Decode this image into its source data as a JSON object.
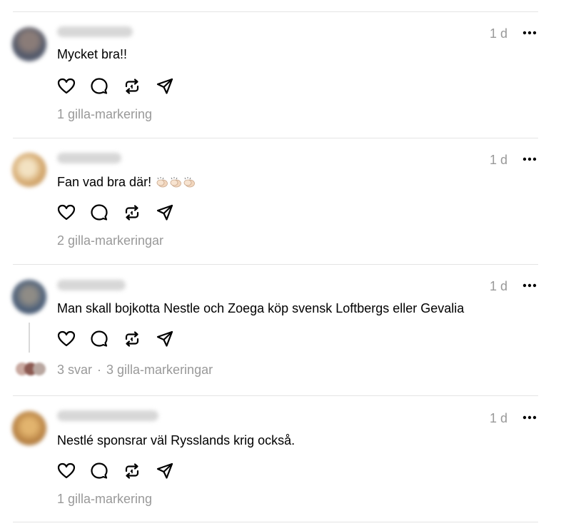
{
  "comments": [
    {
      "username": "mikebike78",
      "time": "1 d",
      "text": "Mycket bra!!",
      "likes": "1 gilla-markering",
      "avatar_color": "#5d6373"
    },
    {
      "username": "annelisen",
      "time": "1 d",
      "text": "Fan vad bra där!",
      "likes": "2 gilla-markeringar",
      "avatar_color": "#d9b27d"
    },
    {
      "username": "vidjerissen",
      "time": "1 d",
      "text": "Man skall bojkotta Nestle och Zoega köp svensk Loftbergs eller Gevalia",
      "replies": "3 svar",
      "separator": "·",
      "likes": "3 gilla-markeringar",
      "avatar_color": "#4b5d76"
    },
    {
      "username": "pellejohansolin",
      "time": "1 d",
      "text": "Nestlé sponsrar väl Rysslands krig också.",
      "likes": "1 gilla-markering",
      "avatar_color": "#c58c4a"
    }
  ],
  "icons": [
    "heart-icon",
    "comment-icon",
    "repost-icon",
    "share-icon",
    "more-icon",
    "clap-emoji"
  ]
}
